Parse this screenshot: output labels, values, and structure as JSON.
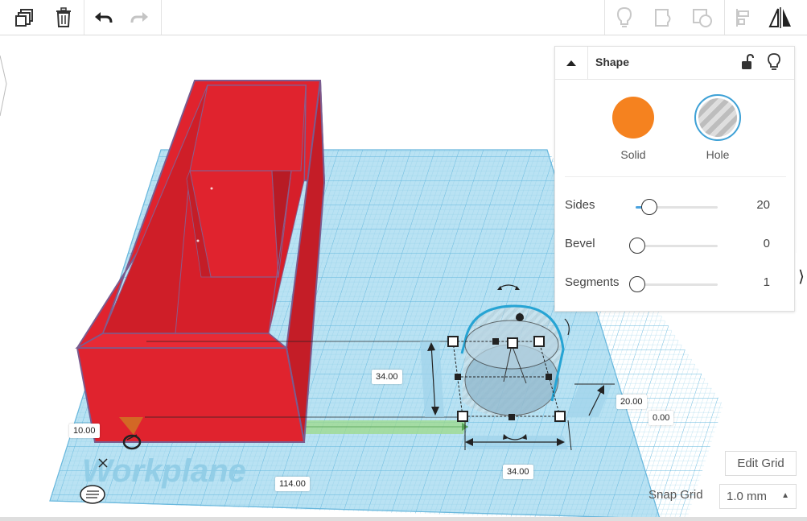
{
  "toolbar": {
    "left_tools": [
      "copy-icon",
      "delete-icon",
      "undo-icon",
      "redo-icon"
    ],
    "right_tools": [
      "lightbulb-icon",
      "group-icon",
      "ungroup-icon",
      "align-icon",
      "mirror-icon"
    ]
  },
  "shape_panel": {
    "title": "Shape",
    "solid_label": "Solid",
    "hole_label": "Hole",
    "solid_color": "#f5821f",
    "properties": [
      {
        "label": "Sides",
        "value": "20",
        "fraction": 0.15
      },
      {
        "label": "Bevel",
        "value": "0",
        "fraction": 0.0
      },
      {
        "label": "Segments",
        "value": "1",
        "fraction": 0.0
      }
    ]
  },
  "dimensions": {
    "height": "34.00",
    "elevation": "20.00",
    "offset": "0.00",
    "width": "34.00",
    "left_small": "10.00",
    "length": "114.00"
  },
  "workplane_label": "Workplane",
  "edit_grid_label": "Edit Grid",
  "snap_grid": {
    "label": "Snap Grid",
    "value": "1.0 mm"
  },
  "colors": {
    "workplane": "#a9dbf0",
    "grid_line": "#7cc3e3",
    "box_red": "#e0232e",
    "box_red_dark": "#c41d27",
    "hole_blue": "#26a4d4"
  }
}
